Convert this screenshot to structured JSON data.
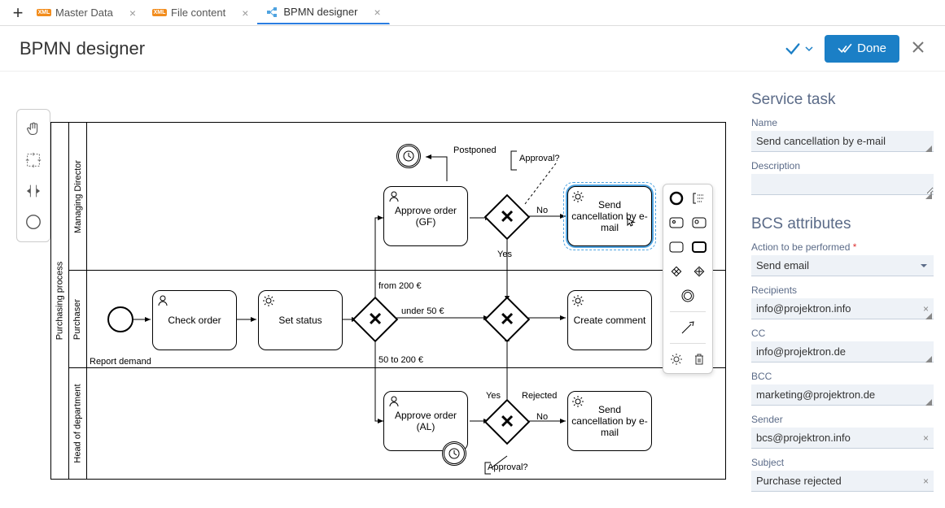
{
  "tabs": {
    "items": [
      {
        "label": "Master Data",
        "icon": "xml",
        "active": false
      },
      {
        "label": "File content",
        "icon": "xml",
        "active": false
      },
      {
        "label": "BPMN designer",
        "icon": "bpmn",
        "active": true
      }
    ]
  },
  "title": "BPMN designer",
  "done_button": "Done",
  "toolbox": {
    "items": [
      "hand-tool",
      "lasso-tool",
      "space-tool",
      "create-start-event"
    ]
  },
  "pool": {
    "name": "Purchasing process",
    "lanes": [
      {
        "name": "Managing Director"
      },
      {
        "name": "Purchaser"
      },
      {
        "name": "Head of department"
      }
    ]
  },
  "nodes": {
    "start_event_label": "Report demand",
    "check_order": "Check order",
    "set_status": "Set status",
    "approve_gf": "Approve order (GF)",
    "approve_al": "Approve order (AL)",
    "send_cancel_top": "Send cancellation by e-mail",
    "send_cancel_bottom": "Send cancellation by e-mail",
    "create_comment": "Create comment"
  },
  "labels": {
    "postponed": "Postponed",
    "approval_top": "Approval?",
    "approval_bottom": "Approval?",
    "no_top": "No",
    "yes_mid": "Yes",
    "yes_bottom": "Yes",
    "no_bottom": "No",
    "rejected_bottom": "Rejected",
    "from_200": "from 200 €",
    "under_50": "under 50 €",
    "range_50_200": "50 to 200 €"
  },
  "panel": {
    "section_task": "Service task",
    "name_label": "Name",
    "name_value": "Send cancellation by e-mail",
    "description_label": "Description",
    "description_value": "",
    "section_bcs": "BCS attributes",
    "action_label": "Action to be performed",
    "action_value": "Send email",
    "recipients_label": "Recipients",
    "recipients_value": "info@projektron.info",
    "cc_label": "CC",
    "cc_value": "info@projektron.de",
    "bcc_label": "BCC",
    "bcc_value": "marketing@projektron.de",
    "sender_label": "Sender",
    "sender_value": "bcs@projektron.info",
    "subject_label": "Subject",
    "subject_value": "Purchase rejected"
  }
}
